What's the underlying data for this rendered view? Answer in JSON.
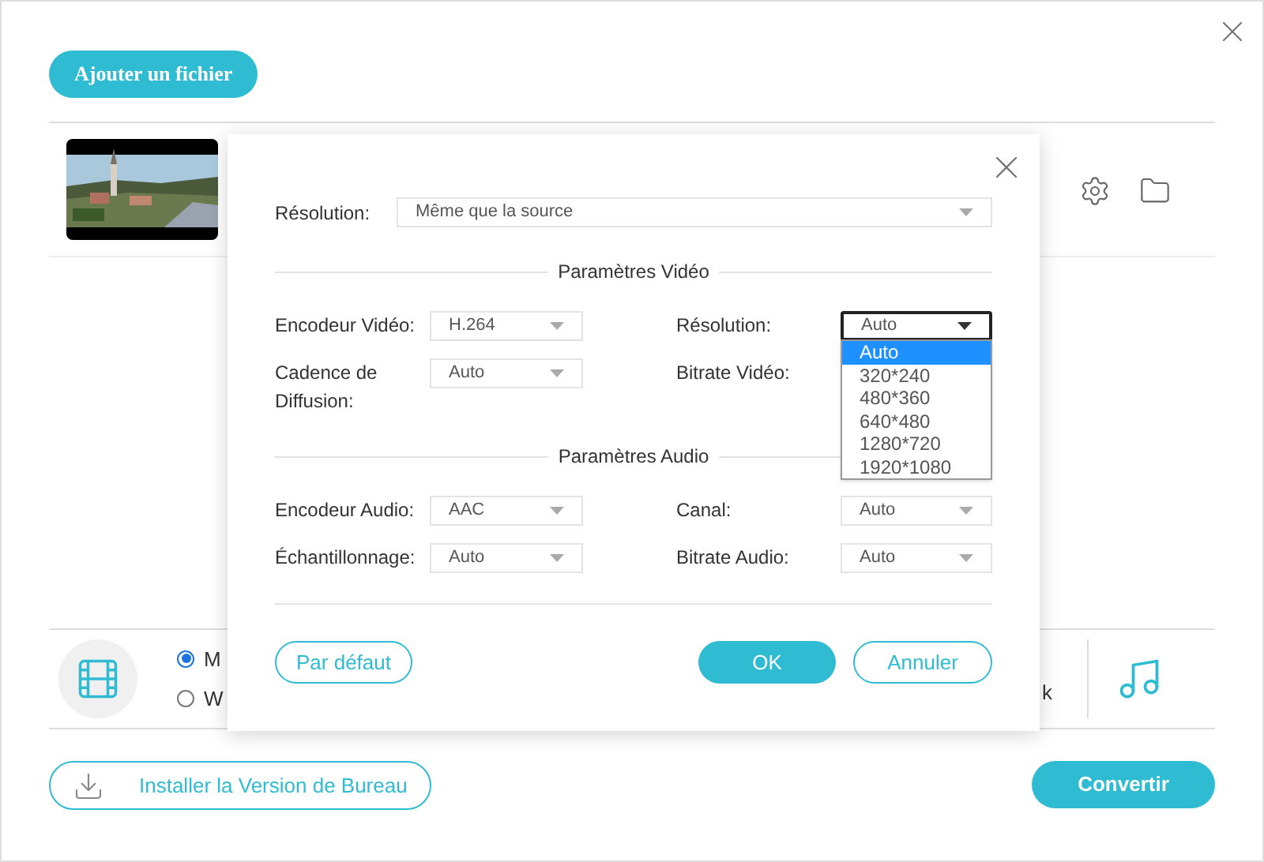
{
  "add_button": "Ajouter un fichier",
  "format_bar": {
    "radios": [
      {
        "label": "M",
        "selected": true
      },
      {
        "label": "W",
        "selected": false
      }
    ],
    "column_3": "k"
  },
  "footer": {
    "install_button": "Installer la Version de Bureau",
    "convert_button": "Convertir"
  },
  "dialog": {
    "resolution": {
      "label": "Résolution:",
      "value": "Même que la source"
    },
    "sections": [
      {
        "title": "Paramètres Vidéo",
        "fields": [
          {
            "label": "Encodeur Vidéo:",
            "value": "H.264",
            "focused": false
          },
          {
            "label": "Résolution:",
            "value": "Auto",
            "focused": true,
            "options": [
              {
                "label": "Auto",
                "selected": true
              },
              {
                "label": "320*240",
                "selected": false
              },
              {
                "label": "480*360",
                "selected": false
              },
              {
                "label": "640*480",
                "selected": false
              },
              {
                "label": "1280*720",
                "selected": false
              },
              {
                "label": "1920*1080",
                "selected": false
              }
            ]
          },
          {
            "label": "Cadence de Diffusion:",
            "value": "Auto",
            "focused": false
          },
          {
            "label": "Bitrate Vidéo:"
          }
        ]
      },
      {
        "title": "Paramètres Audio",
        "fields": [
          {
            "label": "Encodeur Audio:",
            "value": "AAC",
            "focused": false
          },
          {
            "label": "Canal:",
            "value": "Auto",
            "focused": false
          },
          {
            "label": "Échantillonnage:",
            "value": "Auto",
            "focused": false
          },
          {
            "label": "Bitrate Audio:",
            "value": "Auto",
            "focused": false
          }
        ]
      }
    ],
    "buttons": {
      "default": "Par défaut",
      "ok": "OK",
      "cancel": "Annuler"
    }
  }
}
